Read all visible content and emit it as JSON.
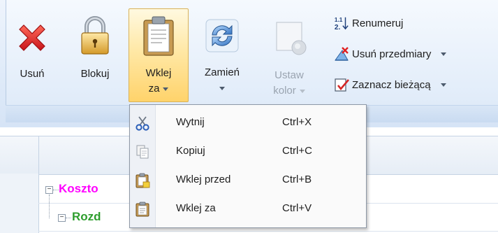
{
  "ribbon": {
    "buttons": {
      "delete": "Usuń",
      "lock": "Blokuj",
      "paste_after_line1": "Wklej",
      "paste_after_line2": "za",
      "replace": "Zamień",
      "set_color_line1": "Ustaw",
      "set_color_line2": "kolor"
    },
    "small": {
      "renumber": "Renumeruj",
      "delete_measurements": "Usuń przedmiary",
      "mark_current": "Zaznacz bieżącą"
    }
  },
  "tree": {
    "row1": "Koszto",
    "row2": "Rozd"
  },
  "menu": {
    "items": [
      {
        "label": "Wytnij",
        "shortcut": "Ctrl+X",
        "icon": "scissors-icon"
      },
      {
        "label": "Kopiuj",
        "shortcut": "Ctrl+C",
        "icon": "copy-icon"
      },
      {
        "label": "Wklej przed",
        "shortcut": "Ctrl+B",
        "icon": "paste-before-icon"
      },
      {
        "label": "Wklej za",
        "shortcut": "Ctrl+V",
        "icon": "paste-after-icon"
      }
    ]
  },
  "colors": {
    "tree_row1": "#ff00ff",
    "tree_row2": "#2e9e2e",
    "highlight": "#ffd36b"
  }
}
